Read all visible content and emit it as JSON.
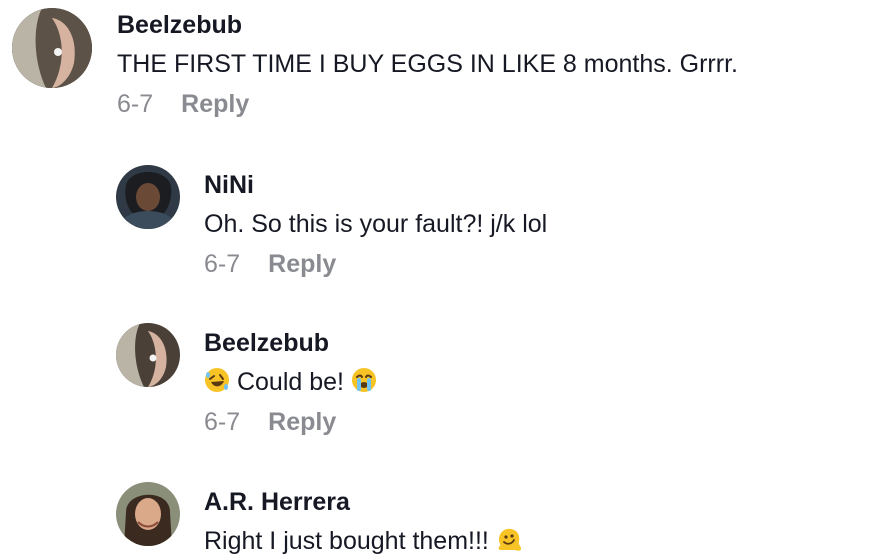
{
  "comments": [
    {
      "username": "Beelzebub",
      "text": "THE FIRST TIME I BUY EGGS IN LIKE 8 months. Grrrr.",
      "date": "6-7",
      "reply_label": "Reply"
    },
    {
      "username": "NiNi",
      "text": "Oh. So this is your fault?! j/k lol",
      "date": "6-7",
      "reply_label": "Reply"
    },
    {
      "username": "Beelzebub",
      "text_before": "",
      "text": "Could be!",
      "date": "6-7",
      "reply_label": "Reply",
      "emoji_before": "rolling-on-floor-laughing-emoji",
      "emoji_after": "loudly-crying-face-emoji"
    },
    {
      "username": "A.R. Herrera",
      "text": "Right I just bought them!!!",
      "emoji_after": "melting-face-emoji"
    }
  ],
  "colors": {
    "text": "#161823",
    "meta": "#8a8b91",
    "emoji_yellow": "#f7c325"
  }
}
